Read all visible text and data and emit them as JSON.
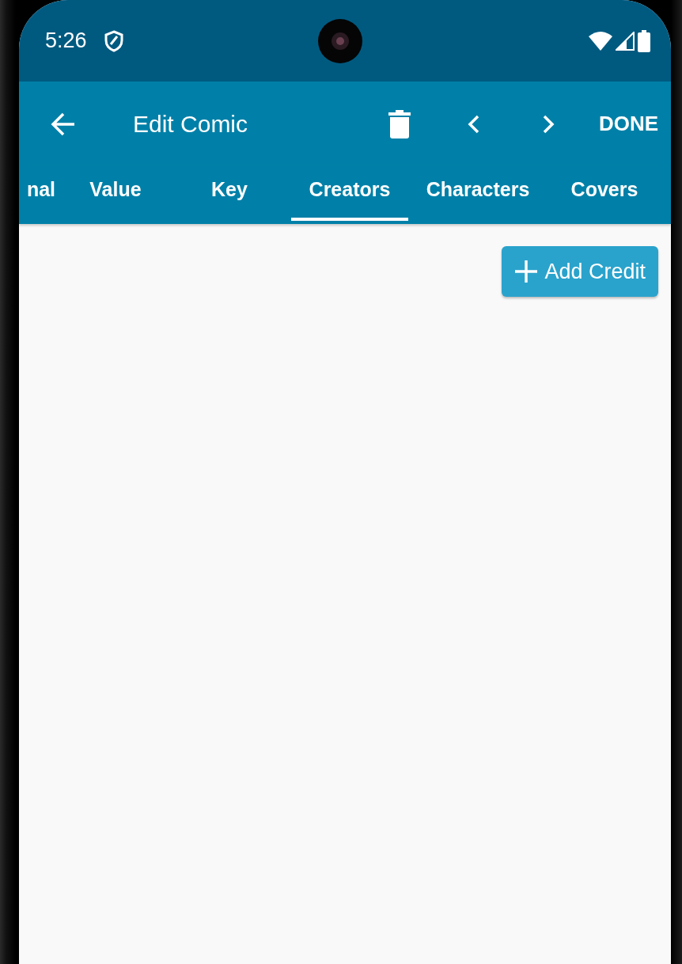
{
  "status_bar": {
    "time": "5:26"
  },
  "app_bar": {
    "title": "Edit Comic",
    "action": "DONE"
  },
  "tabs": [
    {
      "label": "nal",
      "selected": false
    },
    {
      "label": "Value",
      "selected": false
    },
    {
      "label": "Key",
      "selected": false
    },
    {
      "label": "Creators",
      "selected": true
    },
    {
      "label": "Characters",
      "selected": false
    },
    {
      "label": "Covers",
      "selected": false
    }
  ],
  "add_button": {
    "label": "Add Credit"
  }
}
